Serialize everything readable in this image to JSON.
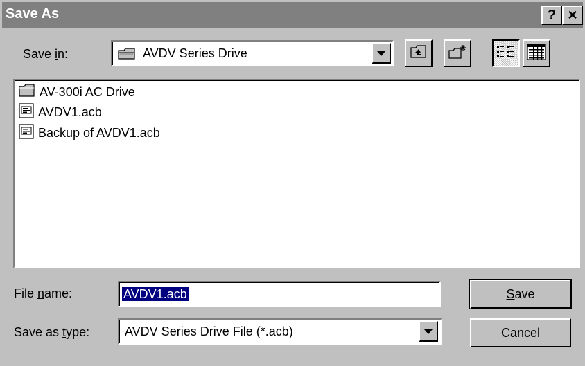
{
  "title": "Save As",
  "titlebar_buttons": {
    "help": "?",
    "close": "✕"
  },
  "save_in": {
    "label_prefix": "Save ",
    "label_mnemonic": "i",
    "label_suffix": "n:",
    "value": "AVDV Series Drive",
    "icon": "drive-folder-icon"
  },
  "toolbar": {
    "up_icon": "up-one-level-icon",
    "new_folder_icon": "create-new-folder-icon",
    "list_icon": "list-view-icon",
    "details_icon": "details-view-icon",
    "active_view": "list"
  },
  "files": [
    {
      "name": "AV-300i AC Drive",
      "icon": "folder-icon"
    },
    {
      "name": "AVDV1.acb",
      "icon": "document-icon"
    },
    {
      "name": "Backup of AVDV1.acb",
      "icon": "document-icon"
    }
  ],
  "file_name": {
    "label_prefix": "File ",
    "label_mnemonic": "n",
    "label_suffix": "ame:",
    "value": "AVDV1.acb"
  },
  "save_as_type": {
    "label_prefix": "Save as ",
    "label_mnemonic": "t",
    "label_suffix": "ype:",
    "value": "AVDV Series Drive File (*.acb)"
  },
  "buttons": {
    "save_mnemonic": "S",
    "save_rest": "ave",
    "cancel": "Cancel"
  },
  "colors": {
    "titlebar": "#808080",
    "face": "#c0c0c0",
    "selection": "#000080"
  }
}
